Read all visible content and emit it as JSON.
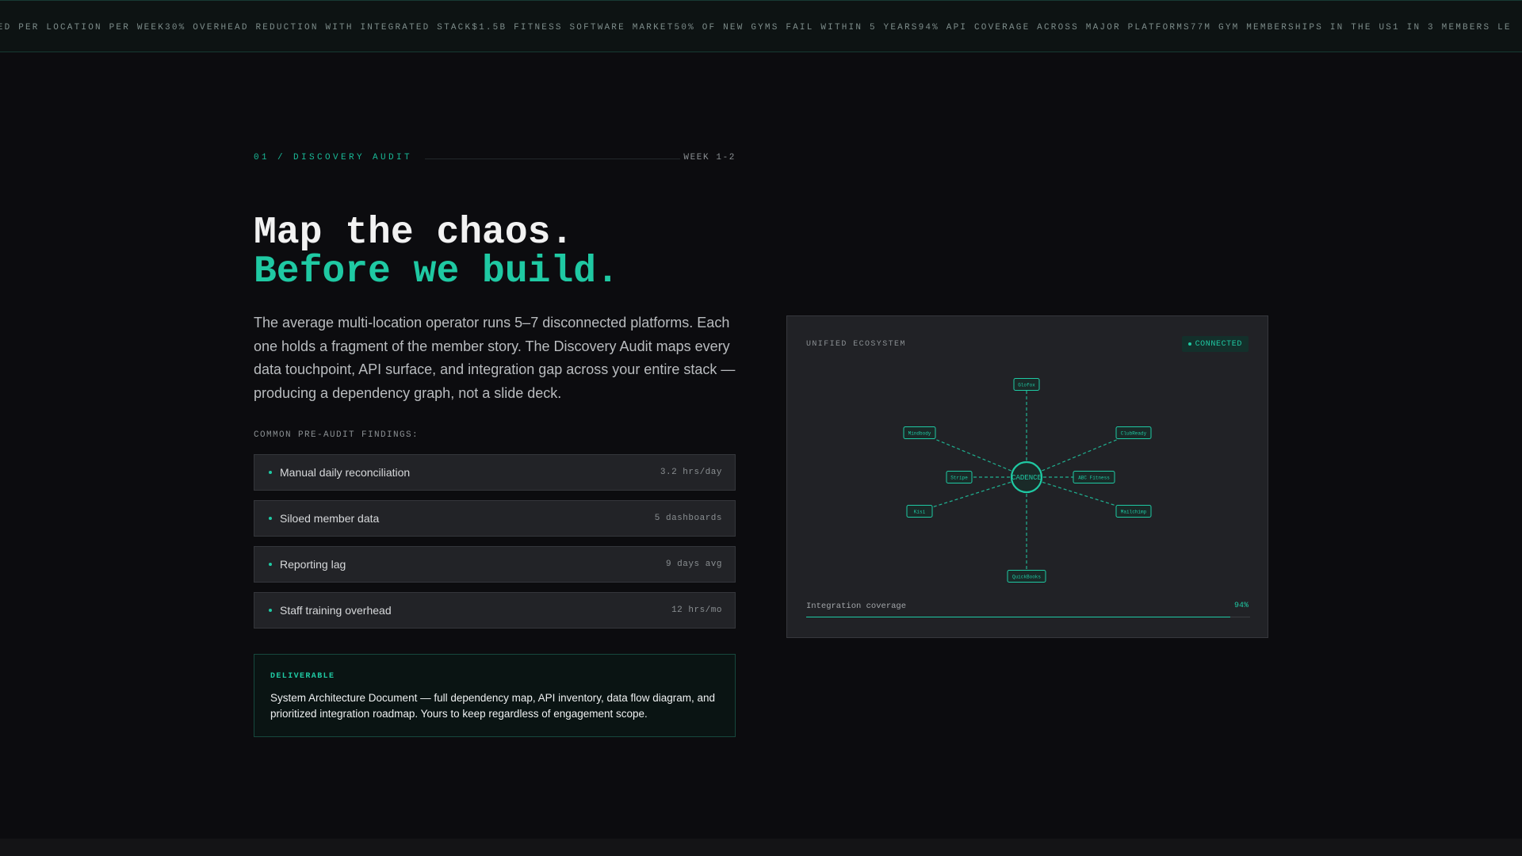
{
  "ticker": {
    "items": [
      "VED PER LOCATION PER WEEK",
      "30% OVERHEAD REDUCTION WITH INTEGRATED STACK",
      "$1.5B FITNESS SOFTWARE MARKET",
      "50% OF NEW GYMS FAIL WITHIN 5 YEARS",
      "94% API COVERAGE ACROSS MAJOR PLATFORMS",
      "77M GYM MEMBERSHIPS IN THE US",
      "1 IN 3 MEMBERS LE"
    ]
  },
  "section": {
    "label": "01 / DISCOVERY AUDIT",
    "week": "WEEK 1-2"
  },
  "headline": {
    "line1": "Map the chaos.",
    "line2": "Before we build."
  },
  "intro": "The average multi-location operator runs 5–7 disconnected platforms. Each one holds a fragment of the member story. The Discovery Audit maps every data touchpoint, API surface, and integration gap across your entire stack — producing a dependency graph, not a slide deck.",
  "findings": {
    "label": "COMMON PRE-AUDIT FINDINGS:",
    "items": [
      {
        "name": "Manual daily reconciliation",
        "metric": "3.2 hrs/day"
      },
      {
        "name": "Siloed member data",
        "metric": "5 dashboards"
      },
      {
        "name": "Reporting lag",
        "metric": "9 days avg"
      },
      {
        "name": "Staff training overhead",
        "metric": "12 hrs/mo"
      }
    ]
  },
  "deliverable": {
    "label": "DELIVERABLE",
    "text": "System Architecture Document — full dependency map, API inventory, data flow diagram, and prioritized integration roadmap. Yours to keep regardless of engagement scope."
  },
  "ecosystem": {
    "title": "UNIFIED ECOSYSTEM",
    "status": "CONNECTED",
    "hub": "CADENCE",
    "nodes": [
      "Glofox",
      "Mindbody",
      "ClubReady",
      "Stripe",
      "ABC Fitness",
      "Kisi",
      "Mailchimp",
      "QuickBooks"
    ],
    "coverage_label": "Integration coverage",
    "coverage_value": "94%",
    "coverage_fraction": 0.94,
    "accent": "#1fc9a3"
  }
}
